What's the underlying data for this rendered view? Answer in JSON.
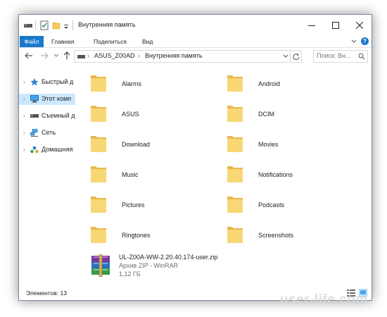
{
  "window": {
    "title": "Внутренняя память"
  },
  "ribbon": {
    "tabs": [
      "Файл",
      "Главная",
      "Поделиться",
      "Вид"
    ]
  },
  "address": {
    "crumbs": [
      "ASUS_Z00AD",
      "Внутренняя память"
    ],
    "search_placeholder": "Поиск: Вн..."
  },
  "nav": {
    "items": [
      {
        "label": "Быстрый д",
        "icon": "star-icon",
        "selected": false
      },
      {
        "label": "Этот комп",
        "icon": "computer-icon",
        "selected": true
      },
      {
        "label": "Съемный д",
        "icon": "drive-icon",
        "selected": false
      },
      {
        "label": "Сеть",
        "icon": "network-icon",
        "selected": false
      },
      {
        "label": "Домашняя",
        "icon": "homegroup-icon",
        "selected": false
      }
    ]
  },
  "folders": [
    "Alarms",
    "Android",
    "ASUS",
    "DCIM",
    "Download",
    "Movies",
    "Music",
    "Notifications",
    "Pictures",
    "Podcasts",
    "Ringtones",
    "Screenshots"
  ],
  "zip_file": {
    "name": "UL-Z00A-WW-2.20.40.174-user.zip",
    "type": "Архив ZIP - WinRAR",
    "size": "1,12 ГБ",
    "icon": "winrar-archive-icon"
  },
  "status": {
    "count_text": "Элементов: 13"
  },
  "watermark": "user-life.com",
  "colors": {
    "accent": "#1979ca",
    "folder": "#f5c95a",
    "selection": "#cce8ff"
  }
}
